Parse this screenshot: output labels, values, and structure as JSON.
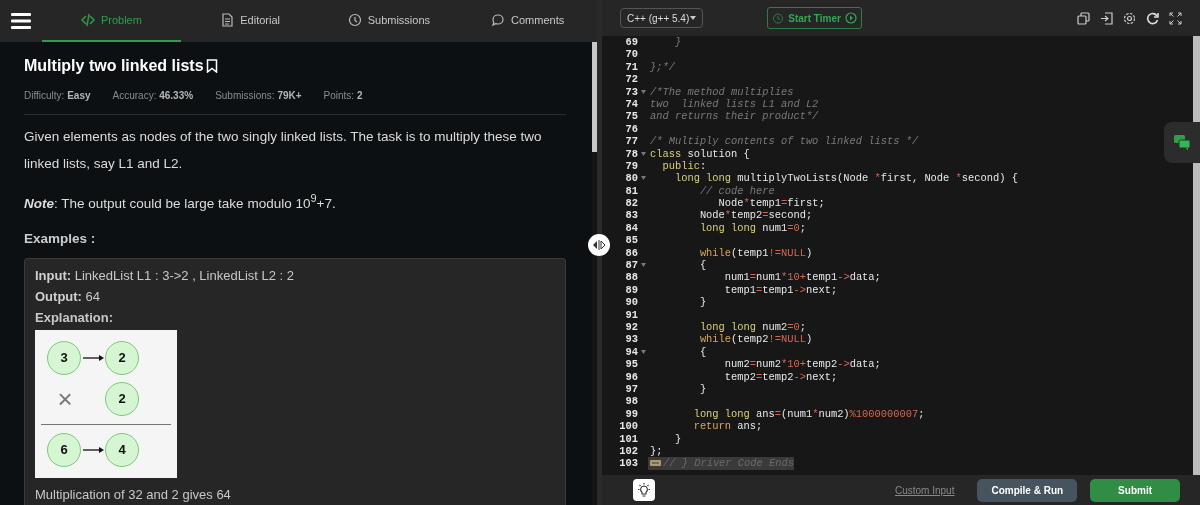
{
  "tabs": [
    {
      "label": "Problem",
      "selected": true
    },
    {
      "label": "Editorial",
      "selected": false
    },
    {
      "label": "Submissions",
      "selected": false
    },
    {
      "label": "Comments",
      "selected": false
    }
  ],
  "problem": {
    "title": "Multiply two linked lists",
    "meta": [
      "Difficulty: **Easy**",
      "Accuracy: **46.33%**",
      "Submissions: **79K+**",
      "Points: **2**"
    ],
    "description": "Given elements as nodes of the two singly linked lists. The task is to multiply these two linked lists, say L1 and L2.",
    "note": "**Note**: The output could be large take modulo 10$^{9}$+7.",
    "examples_heading": "Examples :",
    "example": {
      "input": "**Input:** LinkedList L1 : 3->2 , LinkedList L2 : 2",
      "output": "**Output:** 64",
      "explanation_label": "Explanation:",
      "diagram": {
        "first_list": [
          "3",
          "2"
        ],
        "operator": "×",
        "second_list": [
          "2"
        ],
        "result_list": [
          "6",
          "4"
        ]
      },
      "explanation": "Multiplication of 32 and 2 gives 64"
    }
  },
  "editor": {
    "language": "C++ (g++ 5.4)",
    "timer_button": "Start Timer",
    "lines": [
      {
        "number": "69",
        "foldable": false,
        "tokens": [
          {
            "kind": "comment",
            "text": "    }"
          }
        ]
      },
      {
        "number": "70",
        "foldable": false
      },
      {
        "number": "71",
        "foldable": false,
        "tokens": [
          {
            "kind": "comment",
            "text": "};*/"
          }
        ]
      },
      {
        "number": "72",
        "foldable": false
      },
      {
        "number": "73",
        "foldable": true,
        "tokens": [
          {
            "kind": "comment",
            "text": "/*The method multiplies"
          }
        ]
      },
      {
        "number": "74",
        "foldable": false,
        "tokens": [
          {
            "kind": "comment",
            "text": "two  linked lists L1 and L2"
          }
        ]
      },
      {
        "number": "75",
        "foldable": false,
        "tokens": [
          {
            "kind": "comment",
            "text": "and returns their product*/"
          }
        ]
      },
      {
        "number": "76",
        "foldable": false
      },
      {
        "number": "77",
        "foldable": false,
        "tokens": [
          {
            "kind": "comment",
            "text": "/* Multiply contents of two linked lists */"
          }
        ]
      },
      {
        "number": "78",
        "foldable": true,
        "tokens": [
          {
            "kind": "keyword",
            "text": "class"
          },
          {
            "kind": "plain",
            "text": " solution {"
          }
        ]
      },
      {
        "number": "79",
        "foldable": false,
        "tokens": [
          {
            "kind": "keyword",
            "text": "  public"
          },
          {
            "kind": "plain",
            "text": ":"
          }
        ]
      },
      {
        "number": "80",
        "foldable": true,
        "tokens": [
          {
            "kind": "keyword",
            "text": "    long long"
          },
          {
            "kind": "plain",
            "text": " multiplyTwoLists(Node "
          },
          {
            "kind": "operator",
            "text": "*"
          },
          {
            "kind": "plain",
            "text": "first, Node "
          },
          {
            "kind": "operator",
            "text": "*"
          },
          {
            "kind": "plain",
            "text": "second) {"
          }
        ]
      },
      {
        "number": "81",
        "foldable": false,
        "tokens": [
          {
            "kind": "comment",
            "text": "        // code here"
          }
        ]
      },
      {
        "number": "82",
        "foldable": false,
        "tokens": [
          {
            "kind": "plain",
            "text": "           Node"
          },
          {
            "kind": "operator",
            "text": "*"
          },
          {
            "kind": "plain",
            "text": "temp1"
          },
          {
            "kind": "operator",
            "text": "="
          },
          {
            "kind": "plain",
            "text": "first;"
          }
        ]
      },
      {
        "number": "83",
        "foldable": false,
        "tokens": [
          {
            "kind": "plain",
            "text": "        Node"
          },
          {
            "kind": "operator",
            "text": "*"
          },
          {
            "kind": "plain",
            "text": "temp2"
          },
          {
            "kind": "operator",
            "text": "="
          },
          {
            "kind": "plain",
            "text": "second;"
          }
        ]
      },
      {
        "number": "84",
        "foldable": false,
        "tokens": [
          {
            "kind": "keyword",
            "text": "        long long"
          },
          {
            "kind": "plain",
            "text": " num1"
          },
          {
            "kind": "operator",
            "text": "="
          },
          {
            "kind": "number",
            "text": "0"
          },
          {
            "kind": "plain",
            "text": ";"
          }
        ]
      },
      {
        "number": "85",
        "foldable": false
      },
      {
        "number": "86",
        "foldable": false,
        "tokens": [
          {
            "kind": "control",
            "text": "        while"
          },
          {
            "kind": "plain",
            "text": "(temp1"
          },
          {
            "kind": "operator",
            "text": "!="
          },
          {
            "kind": "number",
            "text": "NULL"
          },
          {
            "kind": "plain",
            "text": ")"
          }
        ]
      },
      {
        "number": "87",
        "foldable": true,
        "tokens": [
          {
            "kind": "plain",
            "text": "        {"
          }
        ]
      },
      {
        "number": "88",
        "foldable": false,
        "tokens": [
          {
            "kind": "plain",
            "text": "            num1"
          },
          {
            "kind": "operator",
            "text": "="
          },
          {
            "kind": "plain",
            "text": "num1"
          },
          {
            "kind": "operator",
            "text": "*"
          },
          {
            "kind": "number",
            "text": "10"
          },
          {
            "kind": "operator",
            "text": "+"
          },
          {
            "kind": "plain",
            "text": "temp1"
          },
          {
            "kind": "operator",
            "text": "->"
          },
          {
            "kind": "plain",
            "text": "data;"
          }
        ]
      },
      {
        "number": "89",
        "foldable": false,
        "tokens": [
          {
            "kind": "plain",
            "text": "            temp1"
          },
          {
            "kind": "operator",
            "text": "="
          },
          {
            "kind": "plain",
            "text": "temp1"
          },
          {
            "kind": "operator",
            "text": "->"
          },
          {
            "kind": "plain",
            "text": "next;"
          }
        ]
      },
      {
        "number": "90",
        "foldable": false,
        "tokens": [
          {
            "kind": "plain",
            "text": "        }"
          }
        ]
      },
      {
        "number": "91",
        "foldable": false
      },
      {
        "number": "92",
        "foldable": false,
        "tokens": [
          {
            "kind": "keyword",
            "text": "        long long"
          },
          {
            "kind": "plain",
            "text": " num2"
          },
          {
            "kind": "operator",
            "text": "="
          },
          {
            "kind": "number",
            "text": "0"
          },
          {
            "kind": "plain",
            "text": ";"
          }
        ]
      },
      {
        "number": "93",
        "foldable": false,
        "tokens": [
          {
            "kind": "control",
            "text": "        while"
          },
          {
            "kind": "plain",
            "text": "(temp2"
          },
          {
            "kind": "operator",
            "text": "!="
          },
          {
            "kind": "number",
            "text": "NULL"
          },
          {
            "kind": "plain",
            "text": ")"
          }
        ]
      },
      {
        "number": "94",
        "foldable": true,
        "tokens": [
          {
            "kind": "plain",
            "text": "        {"
          }
        ]
      },
      {
        "number": "95",
        "foldable": false,
        "tokens": [
          {
            "kind": "plain",
            "text": "            num2"
          },
          {
            "kind": "operator",
            "text": "="
          },
          {
            "kind": "plain",
            "text": "num2"
          },
          {
            "kind": "operator",
            "text": "*"
          },
          {
            "kind": "number",
            "text": "10"
          },
          {
            "kind": "operator",
            "text": "+"
          },
          {
            "kind": "plain",
            "text": "temp2"
          },
          {
            "kind": "operator",
            "text": "->"
          },
          {
            "kind": "plain",
            "text": "data;"
          }
        ]
      },
      {
        "number": "96",
        "foldable": false,
        "tokens": [
          {
            "kind": "plain",
            "text": "            temp2"
          },
          {
            "kind": "operator",
            "text": "="
          },
          {
            "kind": "plain",
            "text": "temp2"
          },
          {
            "kind": "operator",
            "text": "->"
          },
          {
            "kind": "plain",
            "text": "next;"
          }
        ]
      },
      {
        "number": "97",
        "foldable": false,
        "tokens": [
          {
            "kind": "plain",
            "text": "        }"
          }
        ]
      },
      {
        "number": "98",
        "foldable": false
      },
      {
        "number": "99",
        "foldable": false,
        "tokens": [
          {
            "kind": "keyword",
            "text": "       long long"
          },
          {
            "kind": "plain",
            "text": " ans"
          },
          {
            "kind": "operator",
            "text": "="
          },
          {
            "kind": "plain",
            "text": "(num1"
          },
          {
            "kind": "operator",
            "text": "*"
          },
          {
            "kind": "plain",
            "text": "num2)"
          },
          {
            "kind": "operator",
            "text": "%"
          },
          {
            "kind": "number",
            "text": "1000000007"
          },
          {
            "kind": "plain",
            "text": ";"
          }
        ]
      },
      {
        "number": "100",
        "foldable": false,
        "tokens": [
          {
            "kind": "control",
            "text": "       return"
          },
          {
            "kind": "plain",
            "text": " ans;"
          }
        ]
      },
      {
        "number": "101",
        "foldable": false,
        "tokens": [
          {
            "kind": "plain",
            "text": "    }"
          }
        ]
      },
      {
        "number": "102",
        "foldable": false,
        "tokens": [
          {
            "kind": "plain",
            "text": "};"
          }
        ]
      },
      {
        "number": "103",
        "foldable": false,
        "tokens": [
          {
            "kind": "folded",
            "text": "// } Driver Code Ends"
          }
        ]
      }
    ],
    "custom_input": "Custom Input",
    "compile_button": "Compile & Run",
    "submit_button": "Submit"
  }
}
